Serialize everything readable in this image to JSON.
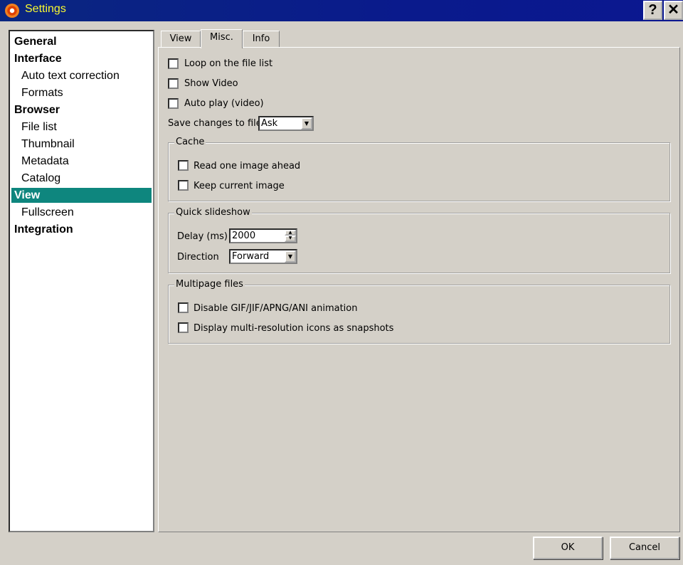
{
  "window": {
    "title": "Settings",
    "help": "?",
    "close": "✕"
  },
  "tree": [
    {
      "label": "General",
      "level": 0
    },
    {
      "label": "Interface",
      "level": 0
    },
    {
      "label": "Auto text correction",
      "level": 1
    },
    {
      "label": "Formats",
      "level": 1
    },
    {
      "label": "Browser",
      "level": 0
    },
    {
      "label": "File list",
      "level": 1
    },
    {
      "label": "Thumbnail",
      "level": 1
    },
    {
      "label": "Metadata",
      "level": 1
    },
    {
      "label": "Catalog",
      "level": 1
    },
    {
      "label": "View",
      "level": 0,
      "selected": true
    },
    {
      "label": "Fullscreen",
      "level": 1
    },
    {
      "label": "Integration",
      "level": 0
    }
  ],
  "tabs": [
    "View",
    "Misc.",
    "Info"
  ],
  "active_tab": "Misc.",
  "misc": {
    "loop": "Loop on the file list",
    "show_video": "Show Video",
    "auto_play": "Auto play (video)",
    "save_label": "Save changes to file",
    "save_value": "Ask",
    "cache": {
      "title": "Cache",
      "read_ahead": "Read one image ahead",
      "keep_current": "Keep current image"
    },
    "slideshow": {
      "title": "Quick slideshow",
      "delay_label": "Delay (ms)",
      "delay_value": "2000",
      "direction_label": "Direction",
      "direction_value": "Forward"
    },
    "multipage": {
      "title": "Multipage files",
      "disable_anim": "Disable GIF/JIF/APNG/ANI animation",
      "display_icons": "Display multi-resolution icons as snapshots"
    }
  },
  "buttons": {
    "ok": "OK",
    "cancel": "Cancel"
  }
}
